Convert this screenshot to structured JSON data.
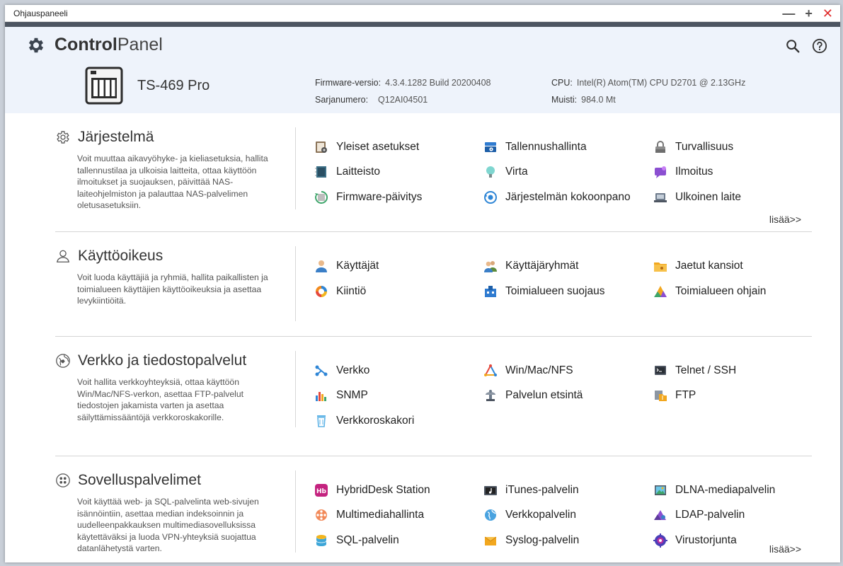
{
  "window": {
    "title": "Ohjauspaneeli"
  },
  "app": {
    "name_bold": "Control",
    "name_light": "Panel"
  },
  "device": {
    "model": "TS-469 Pro",
    "firmware_label": "Firmware-versio:",
    "firmware_value": "4.3.4.1282 Build 20200408",
    "serial_label": "Sarjanumero:",
    "serial_value": "Q12AI04501",
    "cpu_label": "CPU:",
    "cpu_value": "Intel(R) Atom(TM) CPU D2701 @ 2.13GHz",
    "memory_label": "Muisti:",
    "memory_value": "984.0 Mt"
  },
  "colors": {
    "header_bg": "#eef3fb",
    "dark_bar": "#4d5561",
    "close": "#e02b2b"
  },
  "sections": [
    {
      "id": "system",
      "title": "Järjestelmä",
      "icon": "gear-outline-icon",
      "description": "Voit muuttaa aikavyöhyke- ja kieliasetuksia, hallita tallennustilaa ja ulkoisia laitteita, ottaa käyttöön ilmoitukset ja suojauksen, päivittää NAS-laiteohjelmiston ja palauttaa NAS-palvelimen oletusasetuksiin.",
      "items": [
        {
          "label": "Yleiset asetukset",
          "icon": "general-settings-icon"
        },
        {
          "label": "Tallennushallinta",
          "icon": "storage-icon"
        },
        {
          "label": "Turvallisuus",
          "icon": "lock-icon"
        },
        {
          "label": "Laitteisto",
          "icon": "hardware-icon"
        },
        {
          "label": "Virta",
          "icon": "bulb-icon"
        },
        {
          "label": "Ilmoitus",
          "icon": "notification-icon"
        },
        {
          "label": "Firmware-päivitys",
          "icon": "firmware-update-icon"
        },
        {
          "label": "Järjestelmän kokoonpano",
          "icon": "system-config-icon"
        },
        {
          "label": "Ulkoinen laite",
          "icon": "external-device-icon"
        }
      ],
      "more": "lisää>>"
    },
    {
      "id": "privilege",
      "title": "Käyttöoikeus",
      "icon": "user-outline-icon",
      "description": "Voit luoda käyttäjiä ja ryhmiä, hallita paikallisten ja toimialueen käyttäjien käyttöoikeuksia ja asettaa levykiintiöitä.",
      "items": [
        {
          "label": "Käyttäjät",
          "icon": "user-icon"
        },
        {
          "label": "Käyttäjäryhmät",
          "icon": "user-group-icon"
        },
        {
          "label": "Jaetut kansiot",
          "icon": "shared-folder-icon"
        },
        {
          "label": "Kiintiö",
          "icon": "quota-icon"
        },
        {
          "label": "Toimialueen suojaus",
          "icon": "domain-security-icon"
        },
        {
          "label": "Toimialueen ohjain",
          "icon": "domain-controller-icon"
        }
      ]
    },
    {
      "id": "network",
      "title": "Verkko ja tiedostopalvelut",
      "icon": "globe-icon",
      "description": "Voit hallita verkkoyhteyksiä, ottaa käyttöön Win/Mac/NFS-verkon, asettaa FTP-palvelut tiedostojen jakamista varten ja asettaa säilyttämissääntöjä verkkoroskakorille.",
      "items": [
        {
          "label": "Verkko",
          "icon": "network-icon"
        },
        {
          "label": "Win/Mac/NFS",
          "icon": "win-mac-nfs-icon"
        },
        {
          "label": "Telnet / SSH",
          "icon": "terminal-icon"
        },
        {
          "label": "SNMP",
          "icon": "snmp-icon"
        },
        {
          "label": "Palvelun etsintä",
          "icon": "service-discovery-icon"
        },
        {
          "label": "FTP",
          "icon": "ftp-icon"
        },
        {
          "label": "Verkkoroskakori",
          "icon": "recycle-bin-icon"
        }
      ]
    },
    {
      "id": "apps",
      "title": "Sovelluspalvelimet",
      "icon": "apps-grid-icon",
      "description": "Voit käyttää web- ja SQL-palvelinta web-sivujen isännöintiin, asettaa median indeksoinnin ja uudelleenpakkauksen multimediasovelluksissa käytettäväksi ja luoda VPN-yhteyksiä suojattua datanlähetystä varten.",
      "items": [
        {
          "label": "HybridDesk Station",
          "icon": "hybriddesk-icon"
        },
        {
          "label": "iTunes-palvelin",
          "icon": "itunes-icon"
        },
        {
          "label": "DLNA-mediapalvelin",
          "icon": "dlna-icon"
        },
        {
          "label": "Multimediahallinta",
          "icon": "multimedia-icon"
        },
        {
          "label": "Verkkopalvelin",
          "icon": "web-server-icon"
        },
        {
          "label": "LDAP-palvelin",
          "icon": "ldap-icon"
        },
        {
          "label": "SQL-palvelin",
          "icon": "sql-icon"
        },
        {
          "label": "Syslog-palvelin",
          "icon": "syslog-icon"
        },
        {
          "label": "Virustorjunta",
          "icon": "antivirus-icon"
        }
      ],
      "more": "lisää>>"
    }
  ]
}
